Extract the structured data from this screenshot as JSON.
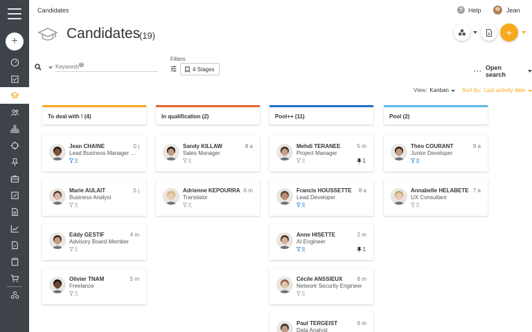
{
  "breadcrumb": "Candidates",
  "help_label": "Help",
  "user_name": "Jean",
  "page": {
    "title": "Candidates",
    "count": "(19)"
  },
  "search": {
    "placeholder": "Keywords"
  },
  "filters": {
    "label": "Filters",
    "stages_label": "4 Stages"
  },
  "open_search": "Open search",
  "view": {
    "label": "View:",
    "value": "Kanban",
    "sort_label": "Sort by:",
    "sort_value": "Last activity date"
  },
  "colors": {
    "sidebar": "#3d4349",
    "accent": "#f6a91d",
    "col1": "#f6a91d",
    "col2": "#e8622a",
    "col3": "#1f6fc5",
    "col4": "#5bb7e6",
    "status_blue": "#5b9ed8",
    "status_gray": "#b0b5ba"
  },
  "columns": [
    {
      "title": "To deal with ! (4)",
      "color": "#f6a91d",
      "cards": [
        {
          "name": "Jean CHAINE",
          "role": "Lead Business Manager at ...",
          "time": "0 j",
          "status": "blue",
          "skin": "#7a5238",
          "hair": "#2b1d14"
        },
        {
          "name": "Marie AULAIT",
          "role": "Business Analyst",
          "time": "5 j",
          "status": "gray",
          "skin": "#d8b9a4",
          "hair": "#5a3c2a"
        },
        {
          "name": "Eddy GESTIF",
          "role": "Advisory Board Member",
          "time": "4 m",
          "status": "gray",
          "skin": "#c79a80",
          "hair": "#3a2a22"
        },
        {
          "name": "Olivier TNAM",
          "role": "Freelance",
          "time": "5 m",
          "status": "gray",
          "skin": "#6b4532",
          "hair": "#1b120d"
        }
      ]
    },
    {
      "title": "In qualification (2)",
      "color": "#e8622a",
      "cards": [
        {
          "name": "Sandy KILLAW",
          "role": "Sales Manager",
          "time": "8 a",
          "status": "gray",
          "skin": "#c49a7e",
          "hair": "#231914"
        },
        {
          "name": "Adrienne KEPOURRA",
          "role": "Translator",
          "time": "6 m",
          "status": "gray",
          "skin": "#e9cdb6",
          "hair": "#d9b57a"
        }
      ]
    },
    {
      "title": "Pool++ (11)",
      "color": "#1f6fc5",
      "cards": [
        {
          "name": "Mehdi TERANEE",
          "role": "Project Manager",
          "time": "5 m",
          "status": "gray",
          "pin": "1",
          "skin": "#c9a08a",
          "hair": "#3b2b23"
        },
        {
          "name": "Francis HOUSSETTE",
          "role": "Lead Developer",
          "time": "8 a",
          "status": "blue",
          "skin": "#b98e73",
          "hair": "#5b4638"
        },
        {
          "name": "Anne HISETTE",
          "role": "AI Engineer",
          "time": "2 m",
          "status": "blue",
          "pin": "1",
          "skin": "#d6b29a",
          "hair": "#4a3023"
        },
        {
          "name": "Cécile ANSSIEUX",
          "role": "Network Security Engineer",
          "time": "8 m",
          "status": "gray",
          "skin": "#e3c4ae",
          "hair": "#8c5a3a"
        },
        {
          "name": "Paul TERGEIST",
          "role": "Data Analyst",
          "time": "6 m",
          "status": "gray",
          "skin": "#c29a80",
          "hair": "#2e2a28"
        }
      ]
    },
    {
      "title": "Pool (2)",
      "color": "#5bb7e6",
      "cards": [
        {
          "name": "Théo COURANT",
          "role": "Junior Developer",
          "time": "9 a",
          "status": "blue",
          "skin": "#c49a7e",
          "hair": "#2b1e17"
        },
        {
          "name": "Annabelle HELABETE",
          "role": "UX Consultant",
          "time": "7 a",
          "status": "gray",
          "skin": "#e8cbb3",
          "hair": "#c9a06a"
        }
      ]
    }
  ]
}
